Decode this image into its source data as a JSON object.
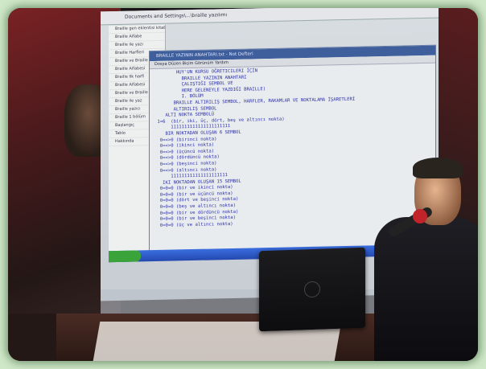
{
  "screen": {
    "titlebar_text": "Documents and Settings\\...\\braille yazılımı",
    "sidebar_items": [
      "Braille gen eklentisi kitabı",
      "Braille Alfabe",
      "Braille ile yazı",
      "Braille Harfleri",
      "Braille ve Braille okuma",
      "Braille Alfabesi",
      "Braille Ilk harfi",
      "Braille Alfabesi",
      "Braille ve Braille",
      "Braille ile yaz",
      "Braille yazıcı",
      "Braille 1 bölüm",
      "Başlangıç",
      "Tablo",
      "Hakkında"
    ],
    "editor_title": "BRAILLE YAZININ ANAHTARI.txt - Not Defteri",
    "editor_menu": "Dosya  Düzen  Biçim  Görünüm  Yardım",
    "editor_lines": [
      "        HUY'UN KURSU OĞRETICILERI İÇİN",
      "          BRAILLE YAZININ ANAHTARI",
      "          ÇALIŞTIĞI SEMBOL VE",
      "          HERE GELENEYLE YAZDIĞI BRAILLE)",
      "          I. BÖLÜM",
      "       BRAILLE ALTIRILIŞ SEMBOL, HARFLER, RAKAMLAR VE NOKTALAMA İŞARETLERİ",
      "       ALTIRILIŞ SEMBOL",
      "    ALTI NOKTA SEMBOLÜ",
      " 1=6  (bir, iki, üç, dört, beş ve altıncı nokta)",
      "      1111111111111111111111",
      "    BIR NOKTADAN OLUŞAN 6 SEMBOL",
      "  0=<>0 (birinci nokta)",
      "  0=<>0 (ikinci nokta)",
      "  0=<>0 (üçüncü nokta)",
      "  0=<>0 (dördüncü nokta)",
      "  0=<>0 (beşinci nokta)",
      "  0=<>0 (altıncı nokta)",
      "      111111111111111111111",
      "   IKI NOKTADAN OLUŞAN 15 SEMBOL",
      "  0=0=0 (bir ve ikinci nokta)",
      "  0=0=0 (bir ve üçüncü nokta)",
      "  0=0=0 (dört ve beşinci nokta)",
      "  0=0=0 (beş ve altıncı nokta)",
      "  0=0=0 (bir ve dördüncü nokta)",
      "  0=0=0 (bir ve beşinci nokta)",
      "  0=0=0 (üç ve altıncı nokta)"
    ]
  },
  "colors": {
    "border_glow": "#cfe8c8",
    "editor_title_bg": "#3e5e9c",
    "editor_text": "#2a2fa8",
    "mic_head": "#c0242a"
  }
}
